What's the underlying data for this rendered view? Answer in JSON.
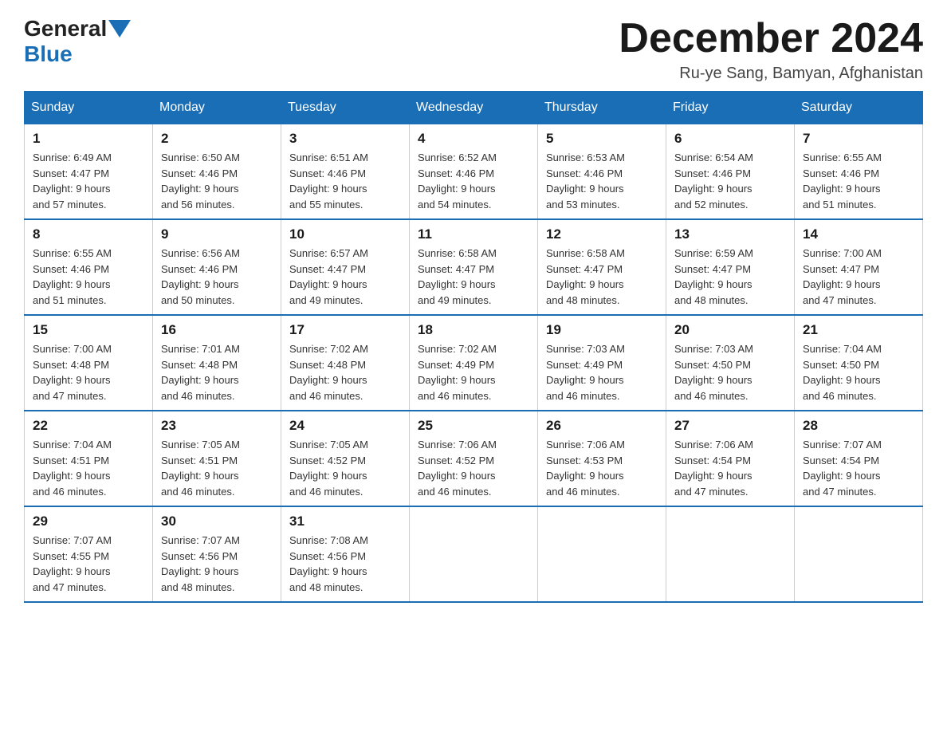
{
  "header": {
    "logo": {
      "general": "General",
      "blue": "Blue"
    },
    "title": "December 2024",
    "location": "Ru-ye Sang, Bamyan, Afghanistan"
  },
  "days_of_week": [
    "Sunday",
    "Monday",
    "Tuesday",
    "Wednesday",
    "Thursday",
    "Friday",
    "Saturday"
  ],
  "weeks": [
    [
      {
        "day": "1",
        "sunrise": "6:49 AM",
        "sunset": "4:47 PM",
        "daylight": "9 hours and 57 minutes."
      },
      {
        "day": "2",
        "sunrise": "6:50 AM",
        "sunset": "4:46 PM",
        "daylight": "9 hours and 56 minutes."
      },
      {
        "day": "3",
        "sunrise": "6:51 AM",
        "sunset": "4:46 PM",
        "daylight": "9 hours and 55 minutes."
      },
      {
        "day": "4",
        "sunrise": "6:52 AM",
        "sunset": "4:46 PM",
        "daylight": "9 hours and 54 minutes."
      },
      {
        "day": "5",
        "sunrise": "6:53 AM",
        "sunset": "4:46 PM",
        "daylight": "9 hours and 53 minutes."
      },
      {
        "day": "6",
        "sunrise": "6:54 AM",
        "sunset": "4:46 PM",
        "daylight": "9 hours and 52 minutes."
      },
      {
        "day": "7",
        "sunrise": "6:55 AM",
        "sunset": "4:46 PM",
        "daylight": "9 hours and 51 minutes."
      }
    ],
    [
      {
        "day": "8",
        "sunrise": "6:55 AM",
        "sunset": "4:46 PM",
        "daylight": "9 hours and 51 minutes."
      },
      {
        "day": "9",
        "sunrise": "6:56 AM",
        "sunset": "4:46 PM",
        "daylight": "9 hours and 50 minutes."
      },
      {
        "day": "10",
        "sunrise": "6:57 AM",
        "sunset": "4:47 PM",
        "daylight": "9 hours and 49 minutes."
      },
      {
        "day": "11",
        "sunrise": "6:58 AM",
        "sunset": "4:47 PM",
        "daylight": "9 hours and 49 minutes."
      },
      {
        "day": "12",
        "sunrise": "6:58 AM",
        "sunset": "4:47 PM",
        "daylight": "9 hours and 48 minutes."
      },
      {
        "day": "13",
        "sunrise": "6:59 AM",
        "sunset": "4:47 PM",
        "daylight": "9 hours and 48 minutes."
      },
      {
        "day": "14",
        "sunrise": "7:00 AM",
        "sunset": "4:47 PM",
        "daylight": "9 hours and 47 minutes."
      }
    ],
    [
      {
        "day": "15",
        "sunrise": "7:00 AM",
        "sunset": "4:48 PM",
        "daylight": "9 hours and 47 minutes."
      },
      {
        "day": "16",
        "sunrise": "7:01 AM",
        "sunset": "4:48 PM",
        "daylight": "9 hours and 46 minutes."
      },
      {
        "day": "17",
        "sunrise": "7:02 AM",
        "sunset": "4:48 PM",
        "daylight": "9 hours and 46 minutes."
      },
      {
        "day": "18",
        "sunrise": "7:02 AM",
        "sunset": "4:49 PM",
        "daylight": "9 hours and 46 minutes."
      },
      {
        "day": "19",
        "sunrise": "7:03 AM",
        "sunset": "4:49 PM",
        "daylight": "9 hours and 46 minutes."
      },
      {
        "day": "20",
        "sunrise": "7:03 AM",
        "sunset": "4:50 PM",
        "daylight": "9 hours and 46 minutes."
      },
      {
        "day": "21",
        "sunrise": "7:04 AM",
        "sunset": "4:50 PM",
        "daylight": "9 hours and 46 minutes."
      }
    ],
    [
      {
        "day": "22",
        "sunrise": "7:04 AM",
        "sunset": "4:51 PM",
        "daylight": "9 hours and 46 minutes."
      },
      {
        "day": "23",
        "sunrise": "7:05 AM",
        "sunset": "4:51 PM",
        "daylight": "9 hours and 46 minutes."
      },
      {
        "day": "24",
        "sunrise": "7:05 AM",
        "sunset": "4:52 PM",
        "daylight": "9 hours and 46 minutes."
      },
      {
        "day": "25",
        "sunrise": "7:06 AM",
        "sunset": "4:52 PM",
        "daylight": "9 hours and 46 minutes."
      },
      {
        "day": "26",
        "sunrise": "7:06 AM",
        "sunset": "4:53 PM",
        "daylight": "9 hours and 46 minutes."
      },
      {
        "day": "27",
        "sunrise": "7:06 AM",
        "sunset": "4:54 PM",
        "daylight": "9 hours and 47 minutes."
      },
      {
        "day": "28",
        "sunrise": "7:07 AM",
        "sunset": "4:54 PM",
        "daylight": "9 hours and 47 minutes."
      }
    ],
    [
      {
        "day": "29",
        "sunrise": "7:07 AM",
        "sunset": "4:55 PM",
        "daylight": "9 hours and 47 minutes."
      },
      {
        "day": "30",
        "sunrise": "7:07 AM",
        "sunset": "4:56 PM",
        "daylight": "9 hours and 48 minutes."
      },
      {
        "day": "31",
        "sunrise": "7:08 AM",
        "sunset": "4:56 PM",
        "daylight": "9 hours and 48 minutes."
      },
      null,
      null,
      null,
      null
    ]
  ],
  "labels": {
    "sunrise": "Sunrise:",
    "sunset": "Sunset:",
    "daylight": "Daylight:"
  }
}
